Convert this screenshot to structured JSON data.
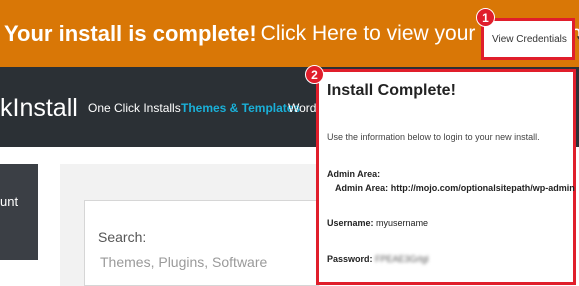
{
  "banner": {
    "bold_text": "Your install is complete!",
    "text": "Click Here to view your notifications"
  },
  "header": {
    "logo_text": "kInstall",
    "nav": [
      {
        "label": "One Click Installs"
      },
      {
        "label": "Themes & Templates"
      },
      {
        "label": "WordP"
      }
    ]
  },
  "sidebar": {
    "label": "unt"
  },
  "search": {
    "label": "Search:",
    "placeholder": "Themes, Plugins, Software"
  },
  "credentials_button": {
    "label": "View Credentials",
    "caret": "▼"
  },
  "badges": [
    "1",
    "2"
  ],
  "popup": {
    "title": "Install Complete!",
    "description": "Use the information below to login to your new install.",
    "admin_area_heading": "Admin Area:",
    "admin_area_label": "Admin Area:",
    "admin_area_url": "http://mojo.com/optionalsitepath/wp-admin",
    "username_label": "Username:",
    "username_value": "myusername",
    "password_label": "Password:",
    "password_value": "FPEAE3Grlgl"
  },
  "colors": {
    "banner": "#d97706",
    "header": "#2b3035",
    "accent": "#1ab0d8",
    "highlight": "#e01e2b"
  }
}
